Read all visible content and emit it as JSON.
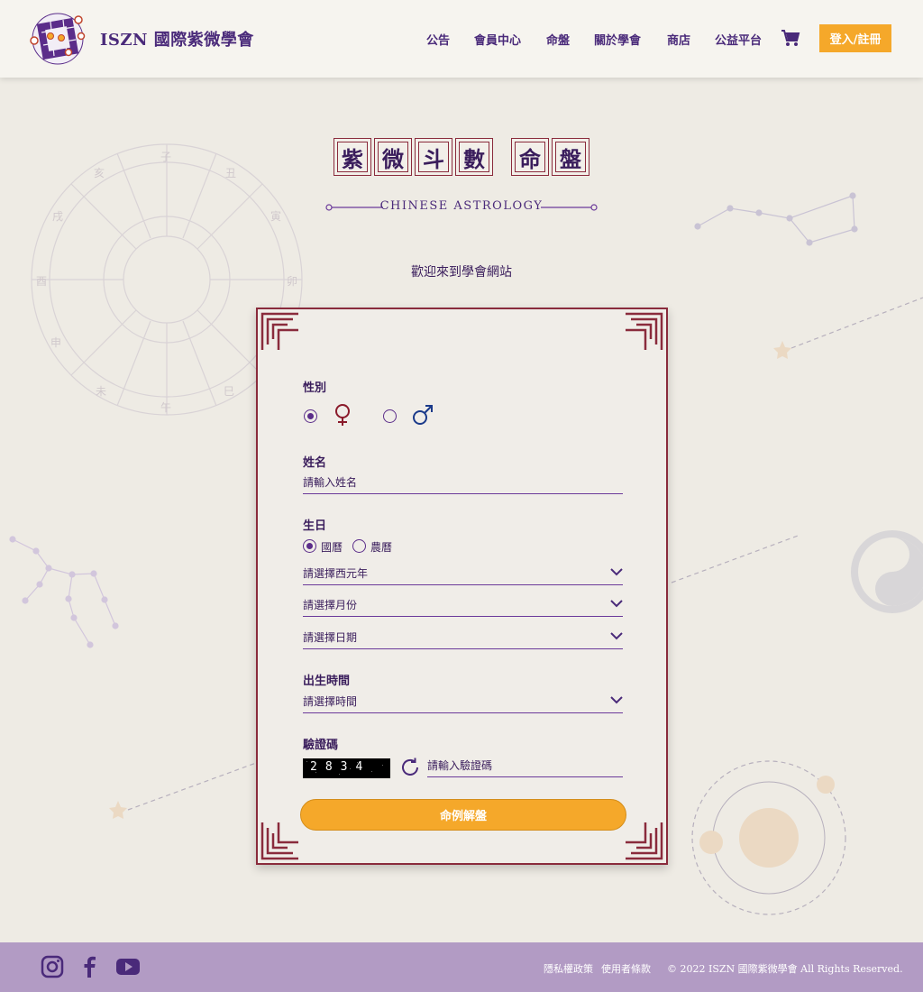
{
  "header": {
    "brand": "ISZN 國際紫微學會",
    "nav": [
      "公告",
      "會員中心",
      "命盤",
      "關於學會",
      "商店",
      "公益平台"
    ],
    "login_label": "登入/註冊"
  },
  "hero": {
    "title_chars": [
      "紫",
      "微",
      "斗",
      "數",
      "命",
      "盤"
    ],
    "subtitle": "CHINESE ASTROLOGY",
    "welcome": "歡迎來到學會網站"
  },
  "form": {
    "gender": {
      "label": "性別",
      "selected": "female",
      "options": [
        {
          "value": "female",
          "icon": "female-symbol-icon",
          "color": "#8a1a2a"
        },
        {
          "value": "male",
          "icon": "male-symbol-icon",
          "color": "#1a3a8a"
        }
      ]
    },
    "name": {
      "label": "姓名",
      "placeholder": "請輸入姓名"
    },
    "birthday": {
      "label": "生日",
      "calendar_options": [
        "國曆",
        "農曆"
      ],
      "calendar_selected": "國曆",
      "year_placeholder": "請選擇西元年",
      "month_placeholder": "請選擇月份",
      "day_placeholder": "請選擇日期"
    },
    "birth_time": {
      "label": "出生時間",
      "placeholder": "請選擇時間"
    },
    "captcha": {
      "label": "驗證碼",
      "code": "2834",
      "placeholder": "請輸入驗證碼"
    },
    "submit_label": "命例解盤"
  },
  "footer": {
    "social": [
      "instagram-icon",
      "facebook-icon",
      "youtube-icon"
    ],
    "links": [
      "隱私權政策",
      "使用者條款"
    ],
    "copyright": "© 2022 ISZN 國際紫微學會 All Rights Reserved."
  },
  "colors": {
    "accent": "#f5a82a",
    "brand_purple": "#4a2a7a",
    "frame_red": "#8a2b3c",
    "footer_bg": "#b29bc4"
  }
}
